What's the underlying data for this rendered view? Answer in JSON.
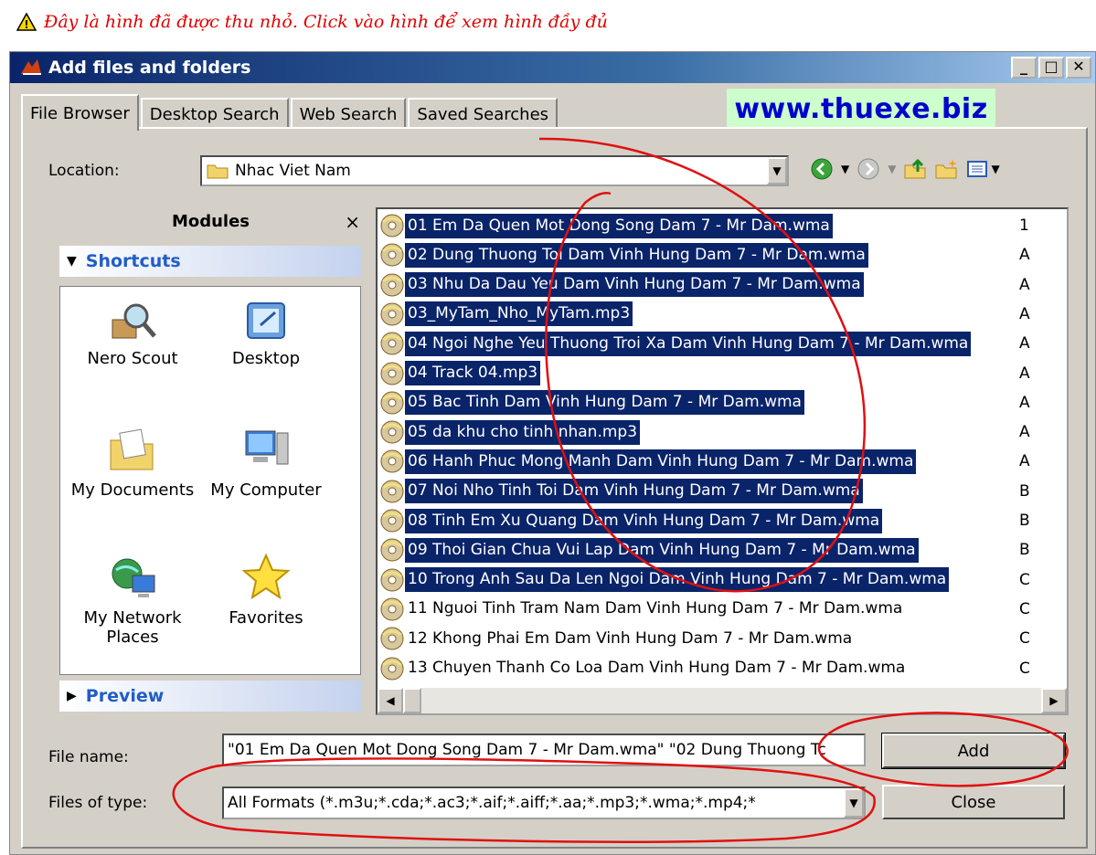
{
  "notice": {
    "text": "Đây là hình đã được thu nhỏ. Click vào hình để xem hình đầy đủ"
  },
  "window": {
    "title": "Add files and folders"
  },
  "tabs": [
    "File Browser",
    "Desktop Search",
    "Web Search",
    "Saved Searches"
  ],
  "watermark": "www.thuexe.biz",
  "location": {
    "label": "Location:",
    "value": "Nhac Viet Nam"
  },
  "modules": {
    "title": "Modules",
    "close": "×",
    "shortcuts_label": "Shortcuts",
    "preview_label": "Preview",
    "items": [
      "Nero Scout",
      "Desktop",
      "My Documents",
      "My Computer",
      "My Network Places",
      "Favorites"
    ]
  },
  "files": [
    {
      "name": "01 Em Da Quen Mot Dong Song Dam 7 - Mr Dam.wma",
      "selected": true
    },
    {
      "name": "02 Dung Thuong Toi Dam Vinh Hung Dam 7 - Mr Dam.wma",
      "selected": true
    },
    {
      "name": "03 Nhu Da Dau Yeu Dam Vinh Hung Dam 7 - Mr Dam.wma",
      "selected": true
    },
    {
      "name": "03_MyTam_Nho_MyTam.mp3",
      "selected": true
    },
    {
      "name": "04 Ngoi Nghe Yeu Thuong Troi Xa Dam Vinh Hung Dam 7 - Mr Dam.wma",
      "selected": true
    },
    {
      "name": "04 Track 04.mp3",
      "selected": true
    },
    {
      "name": "05 Bac Tinh Dam Vinh Hung Dam 7 - Mr Dam.wma",
      "selected": true
    },
    {
      "name": "05 da khu cho tinh nhan.mp3",
      "selected": true
    },
    {
      "name": "06 Hanh Phuc Mong Manh Dam Vinh Hung Dam 7 - Mr Dam.wma",
      "selected": true
    },
    {
      "name": "07 Noi Nho Tinh Toi Dam Vinh Hung Dam 7 - Mr Dam.wma",
      "selected": true
    },
    {
      "name": "08 Tinh Em Xu Quang Dam Vinh Hung Dam 7 - Mr Dam.wma",
      "selected": true
    },
    {
      "name": "09 Thoi Gian Chua Vui Lap Dam Vinh Hung Dam 7 - Mr Dam.wma",
      "selected": true
    },
    {
      "name": "10 Trong Anh Sau Da Len Ngoi Dam Vinh Hung Dam 7 - Mr Dam.wma",
      "selected": true
    },
    {
      "name": "11 Nguoi Tinh Tram Nam Dam Vinh Hung Dam 7 - Mr Dam.wma",
      "selected": false
    },
    {
      "name": "12 Khong Phai Em Dam Vinh Hung Dam 7 - Mr Dam.wma",
      "selected": false
    },
    {
      "name": "13 Chuyen Thanh Co Loa Dam Vinh Hung Dam 7 - Mr Dam.wma",
      "selected": false
    }
  ],
  "second_column": [
    "1",
    "A",
    "A",
    "A",
    "A",
    "A",
    "A",
    "A",
    "A",
    "B",
    "B",
    "B",
    "C",
    "C",
    "C",
    "C"
  ],
  "filename": {
    "label": "File name:",
    "value": "\"01 Em Da Quen Mot Dong Song Dam 7 - Mr Dam.wma\" \"02 Dung Thuong Tc"
  },
  "filetype": {
    "label": "Files of type:",
    "value": "All Formats (*.m3u;*.cda;*.ac3;*.aif;*.aiff;*.aa;*.mp3;*.wma;*.mp4;*"
  },
  "buttons": {
    "add": "Add",
    "close": "Close"
  },
  "colors": {
    "selection": "#0a246a",
    "annotation": "#e01010",
    "notice": "#e00000",
    "watermark": "#0000cc",
    "watermark_bg": "#ccffcc"
  }
}
